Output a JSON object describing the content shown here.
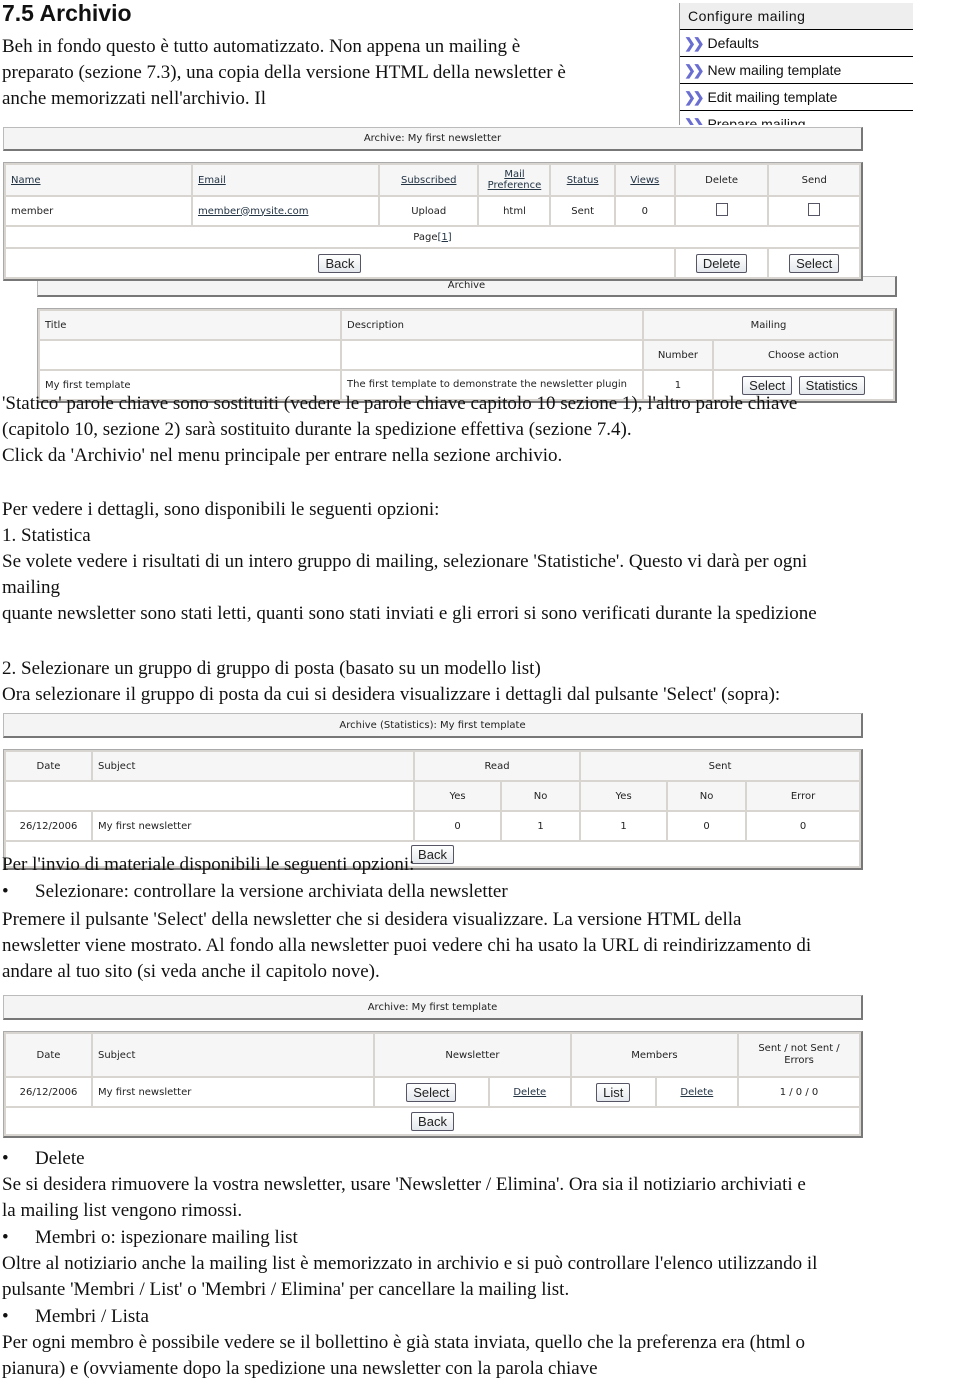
{
  "heading": "7.5 Archivio",
  "intro": [
    "Beh in fondo questo è tutto automatizzato. Non appena un mailing è",
    "preparato (sezione 7.3), una copia della versione HTML della newsletter è",
    "anche memorizzati nell'archivio. Il"
  ],
  "sidebar": {
    "title": "Configure mailing",
    "items": [
      "Defaults",
      "New mailing template",
      "Edit mailing template",
      "Prepare mailing"
    ],
    "icon": "double-chevron-icon"
  },
  "shot1": {
    "title": "Archive: My first newsletter",
    "headers": [
      "Name",
      "Email",
      "Subscribed",
      "Mail Preference",
      "Status",
      "Views",
      "Delete",
      "Send"
    ],
    "row": [
      "member",
      "member@mysite.com",
      "Upload",
      "html",
      "Sent",
      "0"
    ],
    "page_label": "Page",
    "page_num": "[1]",
    "back": "Back",
    "delete": "Delete",
    "select": "Select"
  },
  "shot2": {
    "title": "Archive",
    "headers": [
      "Title",
      "Description",
      "Mailing"
    ],
    "sub": [
      "Number",
      "Choose action"
    ],
    "row": [
      "My first template",
      "The first template to demonstrate the newsletter plugin",
      "1"
    ],
    "select": "Select",
    "statistics": "Statistics"
  },
  "text2": [
    "'Statico' parole chiave sono sostituiti (vedere le parole chiave capitolo 10 sezione 1), l'altro parole chiave",
    "(capitolo 10, sezione 2) sarà sostituito durante la spedizione effettiva (sezione 7.4).",
    "Click da 'Archivio' nel menu principale per entrare nella sezione archivio."
  ],
  "text3": [
    "Per vedere i dettagli, sono disponibili le seguenti opzioni:",
    "1.  Statistica",
    "Se volete vedere i risultati di un intero gruppo di mailing, selezionare 'Statistiche'. Questo vi darà per ogni",
    "mailing",
    "quante newsletter sono stati letti, quanti sono stati inviati e gli errori si sono verificati durante la spedizione"
  ],
  "text4": [
    "2.  Selezionare un gruppo di gruppo di posta (basato su un modello list)",
    "Ora selezionare il gruppo di posta da cui si desidera visualizzare i dettagli dal pulsante 'Select' (sopra):"
  ],
  "shot3": {
    "title": "Archive (Statistics): My first template",
    "headers": [
      "Date",
      "Subject",
      "Read",
      "Sent"
    ],
    "sub": [
      "Yes",
      "No",
      "Yes",
      "No",
      "Error"
    ],
    "row": [
      "26/12/2006",
      "My first newsletter",
      "0",
      "1",
      "1",
      "0",
      "0"
    ],
    "back": "Back"
  },
  "text5": "Per l'invio di materiale disponibili le seguenti opzioni:",
  "bullet1": "Selezionare: controllare la versione archiviata della newsletter",
  "text6": [
    "Premere il pulsante 'Select' della newsletter che si desidera visualizzare. La versione HTML della",
    "newsletter viene mostrato. Al fondo alla newsletter puoi vedere chi ha usato la URL di reindirizzamento di",
    "andare al tuo sito (si veda anche il capitolo nove)."
  ],
  "shot4": {
    "title": "Archive: My first template",
    "headers": [
      "Date",
      "Subject",
      "Newsletter",
      "Members",
      "Sent / not Sent / Errors"
    ],
    "row": [
      "26/12/2006",
      "My first newsletter",
      "1 / 0 / 0"
    ],
    "select": "Select",
    "delete": "Delete",
    "list": "List",
    "back": "Back"
  },
  "bullet2": "Delete",
  "text7": [
    "Se si desidera rimuovere la vostra newsletter, usare 'Newsletter / Elimina'. Ora sia il notiziario archiviati e",
    "la mailing list vengono rimossi."
  ],
  "bullet3": "Membri o: ispezionare mailing list",
  "text8": [
    "Oltre al notiziario anche la mailing list è memorizzato in archivio e si può controllare l'elenco utilizzando il",
    "pulsante 'Membri / List' o 'Membri / Elimina' per cancellare la mailing list."
  ],
  "bullet4": "Membri / Lista",
  "text9": [
    "Per ogni membro è possibile vedere se il bollettino è già stata inviata, quello che la preferenza era (html o",
    "pianura) e (ovviamente dopo la spedizione una newsletter con la parola chiave"
  ]
}
